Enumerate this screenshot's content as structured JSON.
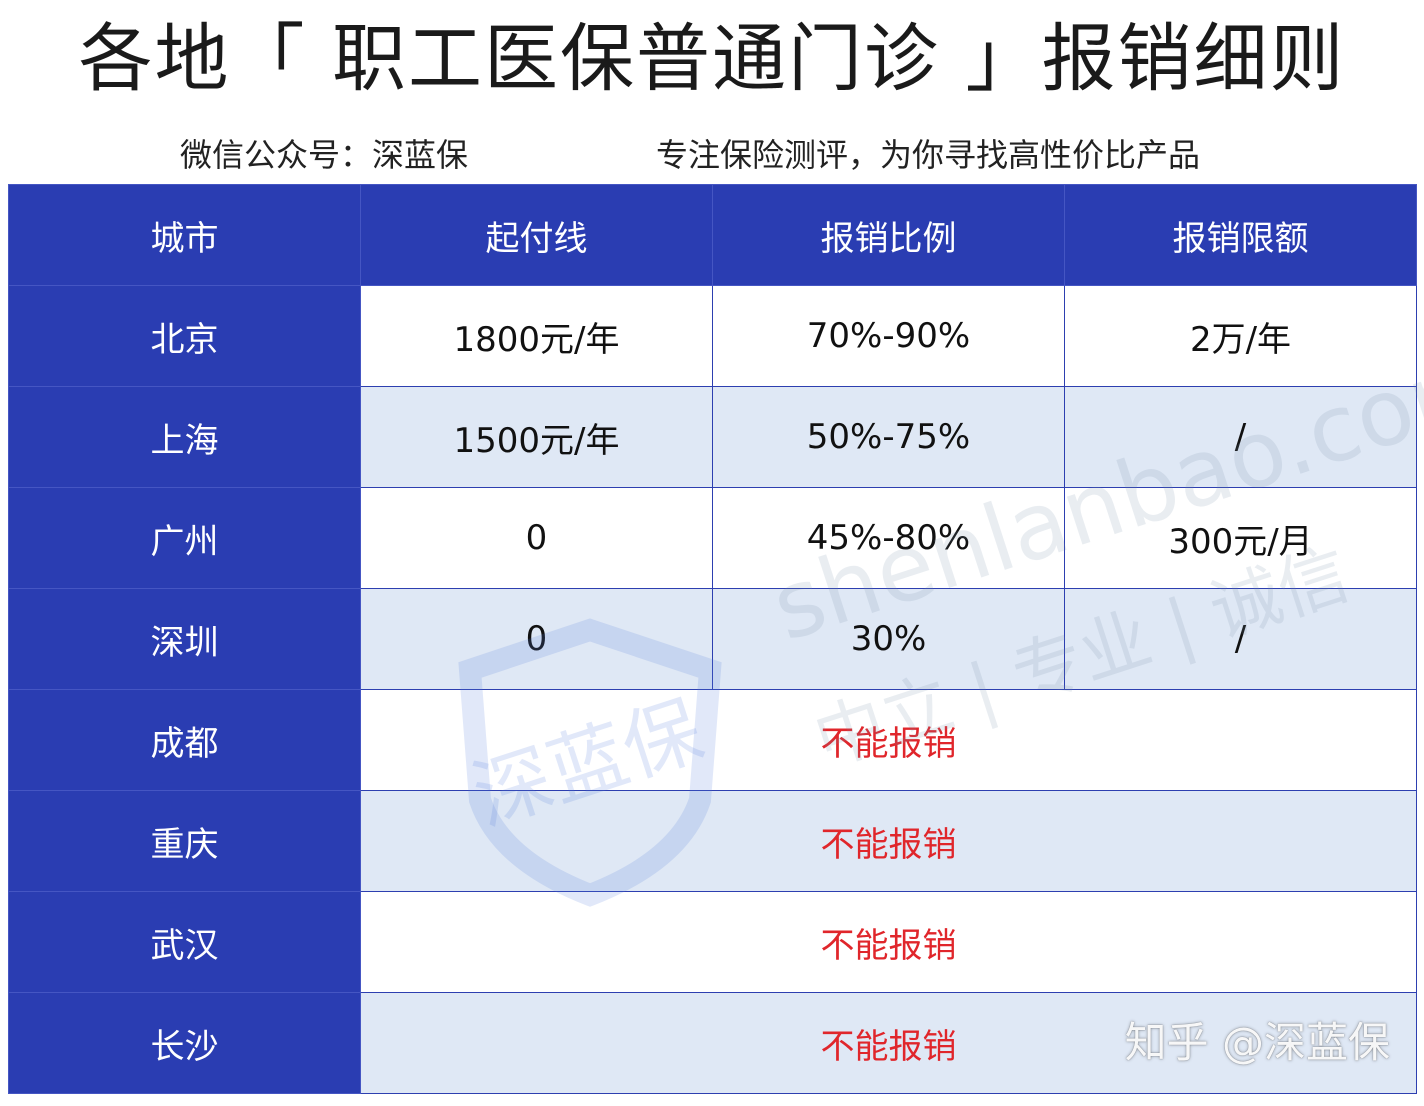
{
  "header": {
    "title": "各地「 职工医保普通门诊 」报销细则",
    "subtitle_left": "微信公众号：深蓝保",
    "subtitle_right": "专注保险测评，为你寻找高性价比产品"
  },
  "table": {
    "headers": [
      "城市",
      "起付线",
      "报销比例",
      "报销限额"
    ],
    "rows": [
      {
        "city": "北京",
        "deductible": "1800元/年",
        "ratio": "70%-90%",
        "limit": "2万/年"
      },
      {
        "city": "上海",
        "deductible": "1500元/年",
        "ratio": "50%-75%",
        "limit": "/"
      },
      {
        "city": "广州",
        "deductible": "0",
        "ratio": "45%-80%",
        "limit": "300元/月"
      },
      {
        "city": "深圳",
        "deductible": "0",
        "ratio": "30%",
        "limit": "/"
      },
      {
        "city": "成都",
        "note": "不能报销"
      },
      {
        "city": "重庆",
        "note": "不能报销"
      },
      {
        "city": "武汉",
        "note": "不能报销"
      },
      {
        "city": "长沙",
        "note": "不能报销"
      }
    ]
  },
  "watermark": {
    "url": "shenlanbao.com",
    "tagline": "中立 | 专业 | 诚信",
    "logo_text": "深蓝保"
  },
  "credit": "知乎 @深蓝保",
  "colors": {
    "header_blue": "#2a3db2",
    "row_alt": "#dfe8f5",
    "no_reimb_red": "#e0262b"
  }
}
